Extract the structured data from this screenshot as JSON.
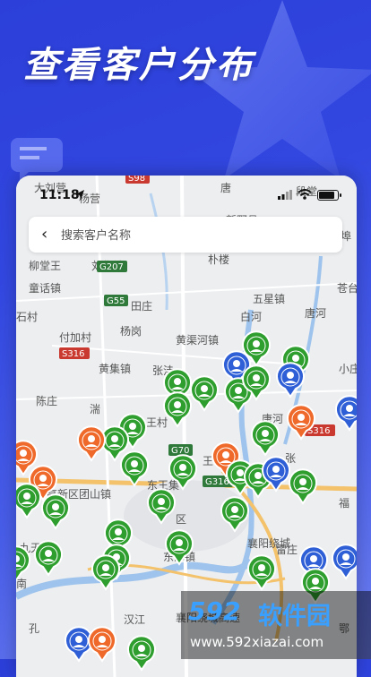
{
  "promo": {
    "title": "查看客户分布"
  },
  "status_bar": {
    "time": "11:18"
  },
  "search": {
    "placeholder": "搜索客户名称",
    "back_icon": "chevron-left-icon"
  },
  "map": {
    "place_labels": [
      "大刘营",
      "杨营",
      "S98",
      "唐",
      "段堂",
      "新野县",
      "柳堂王",
      "刘集镇",
      "朴楼",
      "埠",
      "童话镇",
      "G207",
      "五星镇",
      "苍台",
      "石村",
      "G55",
      "田庄",
      "白河",
      "唐河",
      "付加村",
      "杨岗",
      "黄渠河镇",
      "S316",
      "黄集镇",
      "张洼",
      "小庄",
      "陈庄",
      "湍",
      "唐河",
      "王村",
      "S316",
      "G70",
      "王桥",
      "张",
      "高新区团山镇",
      "东王集",
      "G316",
      "区",
      "襄阳绕城",
      "九天",
      "雷庄",
      "南",
      "东津镇",
      "福",
      "汉江",
      "襄阳绕城高速",
      "孔",
      "鄂"
    ],
    "marker_colors": {
      "green": "#2e9e2e",
      "orange": "#ef6a2a",
      "blue": "#2f5fd6"
    }
  },
  "watermark": {
    "number": "592",
    "name": "软件园",
    "url": "www.592xiazai.com"
  }
}
